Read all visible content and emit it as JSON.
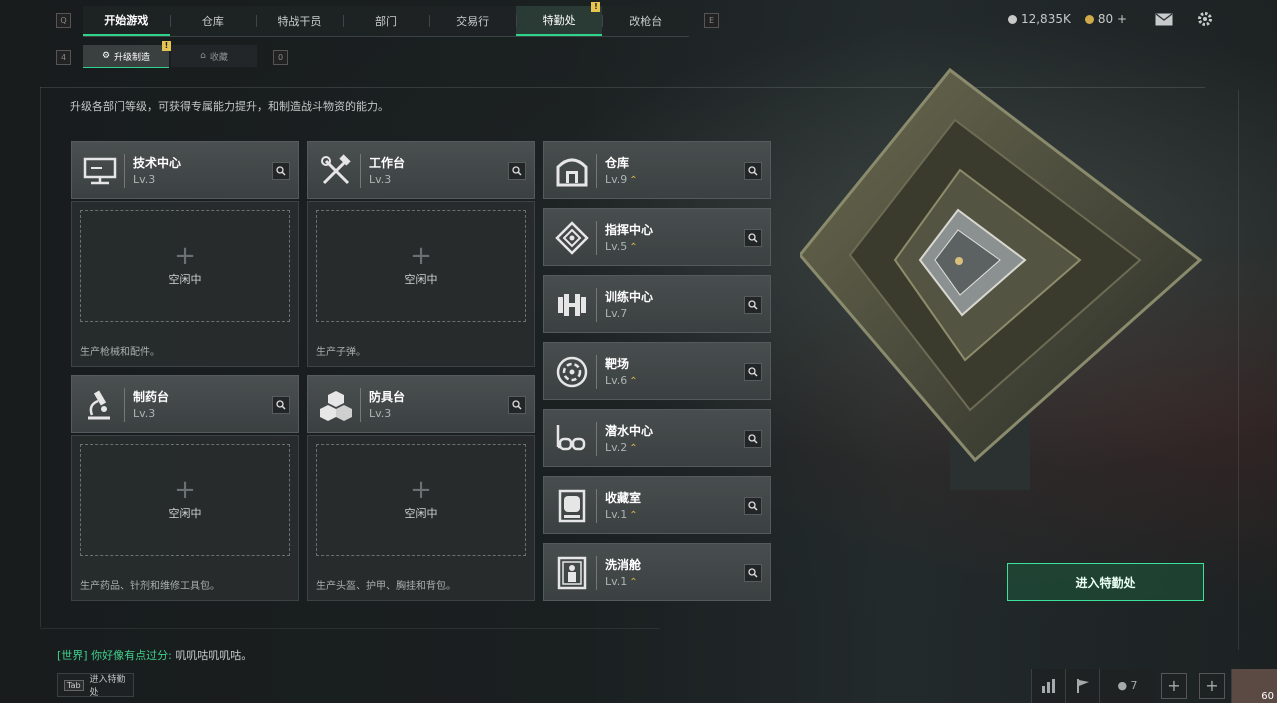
{
  "topbar": {
    "key_left": "Q",
    "key_right": "E",
    "tabs": [
      {
        "label": "开始游戏"
      },
      {
        "label": "仓库"
      },
      {
        "label": "特战干员"
      },
      {
        "label": "部门"
      },
      {
        "label": "交易行"
      },
      {
        "label": "特勤处",
        "badge": "!"
      },
      {
        "label": "改枪台"
      }
    ],
    "currency": "12,835K",
    "tickets": "80",
    "tickets_add": "+"
  },
  "subtabs": {
    "key_left": "4",
    "key_right": "0",
    "items": [
      {
        "label": "升级制造",
        "badge": "!"
      },
      {
        "label": "收藏"
      }
    ]
  },
  "description": "升级各部门等级，可获得专属能力提升，和制造战斗物资的能力。",
  "production": [
    {
      "name": "技术中心",
      "level": "Lv.3",
      "icon": "computer-icon",
      "slot": "空闲中",
      "desc": "生产枪械和配件。"
    },
    {
      "name": "工作台",
      "level": "Lv.3",
      "icon": "tools-icon",
      "slot": "空闲中",
      "desc": "生产子弹。"
    },
    {
      "name": "制药台",
      "level": "Lv.3",
      "icon": "microscope-icon",
      "slot": "空闲中",
      "desc": "生产药品、针剂和维修工具包。"
    },
    {
      "name": "防具台",
      "level": "Lv.3",
      "icon": "cubes-icon",
      "slot": "空闲中",
      "desc": "生产头盔、护甲、胸挂和背包。"
    }
  ],
  "facilities": [
    {
      "name": "仓库",
      "level": "Lv.9",
      "upgrade": true,
      "icon": "warehouse-icon"
    },
    {
      "name": "指挥中心",
      "level": "Lv.5",
      "upgrade": true,
      "icon": "command-icon"
    },
    {
      "name": "训练中心",
      "level": "Lv.7",
      "upgrade": false,
      "icon": "dumbbell-icon"
    },
    {
      "name": "靶场",
      "level": "Lv.6",
      "upgrade": true,
      "icon": "target-icon"
    },
    {
      "name": "潜水中心",
      "level": "Lv.2",
      "upgrade": true,
      "icon": "goggles-icon"
    },
    {
      "name": "收藏室",
      "level": "Lv.1",
      "upgrade": true,
      "icon": "display-case-icon"
    },
    {
      "name": "洗消舱",
      "level": "Lv.1",
      "upgrade": true,
      "icon": "decon-chamber-icon"
    }
  ],
  "upgrade_symbol": "⌃",
  "enter_button": "进入特勤处",
  "chat": {
    "channel": "[世界]",
    "sender": "你好像有点过分:",
    "message": "叽叽咕叽叽咕。"
  },
  "tab_hint": {
    "key": "Tab",
    "label": "进入特勤处"
  },
  "bottom": {
    "friends_count": "7",
    "player_level": "60"
  },
  "colors": {
    "accent": "#2fd38a",
    "badge": "#e6c452",
    "upgrade": "#d8b648"
  }
}
